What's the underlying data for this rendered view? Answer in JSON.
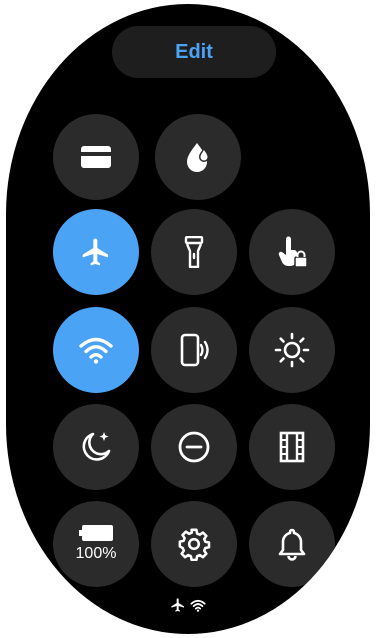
{
  "header": {
    "edit_label": "Edit"
  },
  "tiles": [
    {
      "name": "wallet-tile",
      "icon": "card-icon",
      "active": false
    },
    {
      "name": "water-lock-tile",
      "icon": "water-drop-icon",
      "active": false
    },
    {
      "name": "airplane-mode-tile",
      "icon": "airplane-icon",
      "active": true
    },
    {
      "name": "flashlight-tile",
      "icon": "flashlight-icon",
      "active": false
    },
    {
      "name": "touch-lock-tile",
      "icon": "touch-lock-icon",
      "active": false
    },
    {
      "name": "wifi-tile",
      "icon": "wifi-icon",
      "active": true
    },
    {
      "name": "find-phone-tile",
      "icon": "phone-ring-icon",
      "active": false
    },
    {
      "name": "brightness-tile",
      "icon": "brightness-icon",
      "active": false
    },
    {
      "name": "bedtime-mode-tile",
      "icon": "moon-icon",
      "active": false
    },
    {
      "name": "do-not-disturb-tile",
      "icon": "dnd-icon",
      "active": false
    },
    {
      "name": "theater-mode-tile",
      "icon": "film-icon",
      "active": false
    },
    {
      "name": "battery-tile",
      "icon": "battery-icon",
      "active": false
    },
    {
      "name": "settings-tile",
      "icon": "gear-icon",
      "active": false
    },
    {
      "name": "sound-tile",
      "icon": "bell-icon",
      "active": false
    }
  ],
  "battery": {
    "level_label": "100%"
  },
  "status_bar": {
    "icons": [
      "airplane-icon",
      "wifi-icon"
    ]
  },
  "colors": {
    "accent": "#4aa3f5",
    "tile": "#2b2b2b",
    "background": "#000000"
  }
}
